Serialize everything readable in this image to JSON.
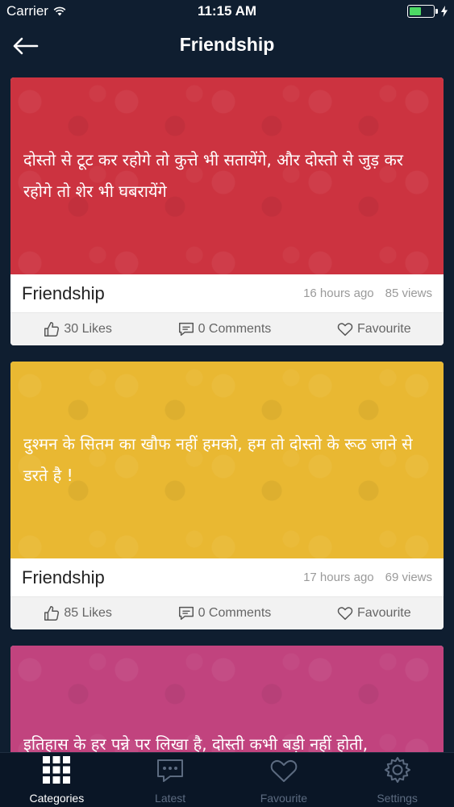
{
  "status": {
    "carrier": "Carrier",
    "time": "11:15 AM",
    "battery_level": 0.5
  },
  "header": {
    "title": "Friendship"
  },
  "cards": [
    {
      "color": "#cc3340",
      "quote": "दोस्तो से टूट कर रहोगे तो कुत्ते भी सतायेंगे, और दोस्तो से जुड़ कर रहोगे तो शेर भी घबरायेंगे",
      "category": "Friendship",
      "time": "16 hours ago",
      "views": "85 views",
      "likes": "30 Likes",
      "comments": "0 Comments",
      "favourite": "Favourite"
    },
    {
      "color": "#e9b832",
      "quote": "दुश्मन के सितम का खौफ नहीं हमको, हम तो दोस्तो के रूठ जाने से डरते है !",
      "category": "Friendship",
      "time": "17 hours ago",
      "views": "69 views",
      "likes": "85 Likes",
      "comments": "0 Comments",
      "favourite": "Favourite"
    },
    {
      "color": "#c1437e",
      "quote": "इतिहास के हर पन्ने पर लिखा है, दोस्ती कभी बड़ी नहीं होती,",
      "category": "",
      "time": "",
      "views": "",
      "likes": "",
      "comments": "",
      "favourite": ""
    }
  ],
  "tabs": [
    {
      "label": "Categories",
      "icon": "grid-icon",
      "active": true
    },
    {
      "label": "Latest",
      "icon": "chat-icon",
      "active": false
    },
    {
      "label": "Favourite",
      "icon": "heart-icon",
      "active": false
    },
    {
      "label": "Settings",
      "icon": "gear-icon",
      "active": false
    }
  ]
}
